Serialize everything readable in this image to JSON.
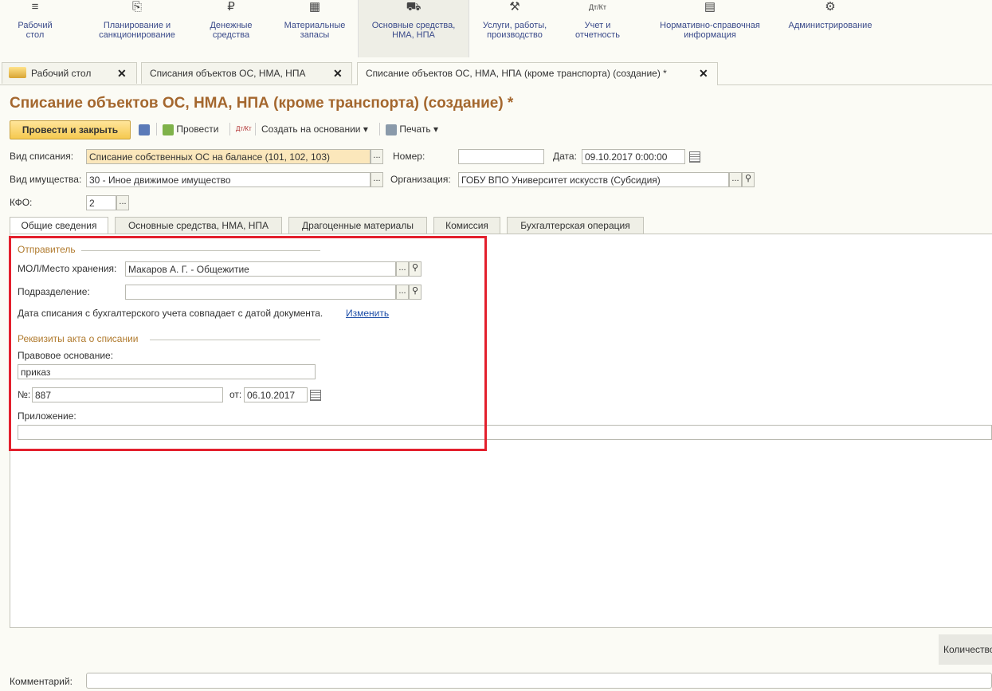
{
  "sections": [
    {
      "icon": "menu-icon",
      "glyph": "≡",
      "line1": "Рабочий",
      "line2": "стол"
    },
    {
      "icon": "planning-icon",
      "glyph": "⎘",
      "line1": "Планирование и",
      "line2": "санкционирование"
    },
    {
      "icon": "ruble-icon",
      "glyph": "₽",
      "line1": "Денежные",
      "line2": "средства"
    },
    {
      "icon": "warehouse-icon",
      "glyph": "▦",
      "line1": "Материальные",
      "line2": "запасы"
    },
    {
      "icon": "truck-icon",
      "glyph": "⛟",
      "line1": "Основные средства,",
      "line2": "НМА, НПА"
    },
    {
      "icon": "tools-icon",
      "glyph": "⚒",
      "line1": "Услуги, работы,",
      "line2": "производство"
    },
    {
      "icon": "debit-credit-icon",
      "glyph": "Дт/Кт",
      "line1": "Учет и",
      "line2": "отчетность"
    },
    {
      "icon": "reference-book-icon",
      "glyph": "▤",
      "line1": "Нормативно-справочная",
      "line2": "информация"
    },
    {
      "icon": "gear-icon",
      "glyph": "⚙",
      "line1": "Администрирование",
      "line2": ""
    }
  ],
  "tabs": [
    {
      "label": "Рабочий стол"
    },
    {
      "label": "Списания объектов ОС, НМА, НПА"
    },
    {
      "label": "Списание объектов ОС, НМА, НПА (кроме транспорта) (создание) *"
    }
  ],
  "form": {
    "title": "Списание объектов ОС, НМА, НПА (кроме транспорта) (создание) *",
    "toolbar": {
      "post_close": "Провести и закрыть",
      "post": "Провести",
      "create_based": "Создать на основании",
      "print": "Печать"
    },
    "fields": {
      "write_off_type_label": "Вид списания:",
      "write_off_type_value": "Списание собственных ОС на балансе (101, 102, 103)",
      "number_label": "Номер:",
      "number_value": "",
      "date_label": "Дата:",
      "date_value": "09.10.2017  0:00:00",
      "property_type_label": "Вид имущества:",
      "property_type_value": "30 - Иное движимое имущество",
      "organization_label": "Организация:",
      "organization_value": "ГОБУ ВПО Университет искусств (Субсидия)",
      "kfo_label": "КФО:",
      "kfo_value": "2"
    },
    "inner_tabs": [
      "Общие сведения",
      "Основные средства, НМА, НПА",
      "Драгоценные материалы",
      "Комиссия",
      "Бухгалтерская операция"
    ],
    "sender": {
      "group_title": "Отправитель",
      "mol_label": "МОЛ/Место хранения:",
      "mol_value": "Макаров А. Г. - Общежитие",
      "dept_label": "Подразделение:",
      "dept_value": "",
      "note": "Дата списания с бухгалтерского учета совпадает с датой документа.",
      "change_link": "Изменить"
    },
    "act": {
      "group_title": "Реквизиты акта о списании",
      "basis_label": "Правовое основание:",
      "basis_value": "приказ",
      "num_label": "№:",
      "num_value": "887",
      "from_label": "от:",
      "from_value": "06.10.2017",
      "attachment_label": "Приложение:",
      "attachment_value": ""
    },
    "quantity_label": "Количество",
    "comment_label": "Комментарий:",
    "comment_value": ""
  }
}
